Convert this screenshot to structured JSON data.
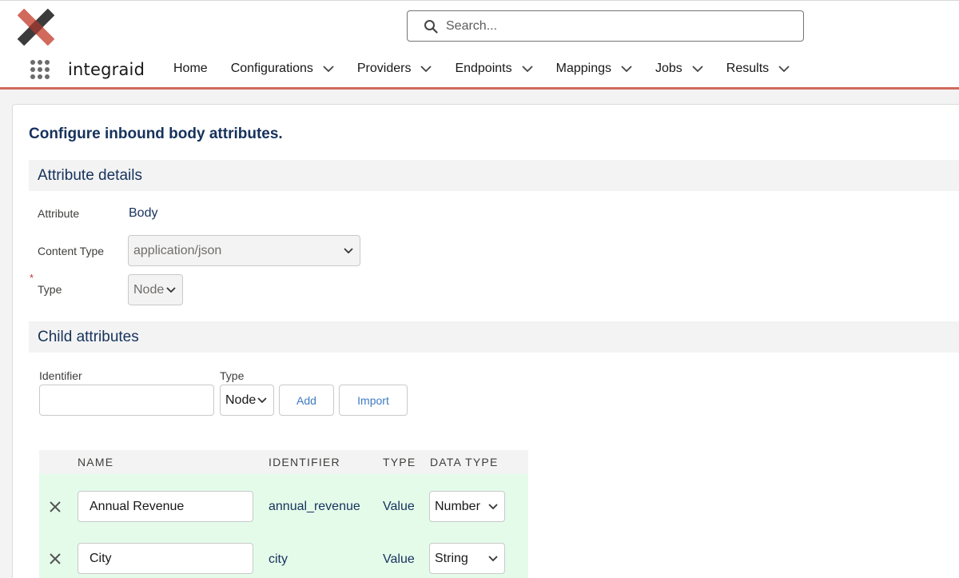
{
  "header": {
    "logo_name": "x-logo",
    "search": {
      "placeholder": "Search..."
    },
    "app_name": "integraid",
    "nav": [
      {
        "label": "Home",
        "has_menu": false
      },
      {
        "label": "Configurations",
        "has_menu": true
      },
      {
        "label": "Providers",
        "has_menu": true
      },
      {
        "label": "Endpoints",
        "has_menu": true
      },
      {
        "label": "Mappings",
        "has_menu": true
      },
      {
        "label": "Jobs",
        "has_menu": true
      },
      {
        "label": "Results",
        "has_menu": true
      }
    ],
    "accent_color": "#d1695c"
  },
  "page": {
    "title": "Configure inbound body attributes."
  },
  "attribute_details": {
    "heading": "Attribute details",
    "attribute_label": "Attribute",
    "attribute_value": "Body",
    "content_type_label": "Content Type",
    "content_type_value": "application/json",
    "required_marker": "*",
    "type_label": "Type",
    "type_value": "Node"
  },
  "child_attributes": {
    "heading": "Child attributes",
    "identifier_label": "Identifier",
    "identifier_value": "",
    "type_label": "Type",
    "type_value": "Node",
    "add_label": "Add",
    "import_label": "Import"
  },
  "table": {
    "columns": [
      "NAME",
      "IDENTIFIER",
      "TYPE",
      "DATA TYPE"
    ],
    "rows": [
      {
        "name": "Annual Revenue",
        "identifier": "annual_revenue",
        "type": "Value",
        "data_type": "Number"
      },
      {
        "name": "City",
        "identifier": "city",
        "type": "Value",
        "data_type": "String"
      }
    ],
    "row_color": "#e4fbea"
  }
}
